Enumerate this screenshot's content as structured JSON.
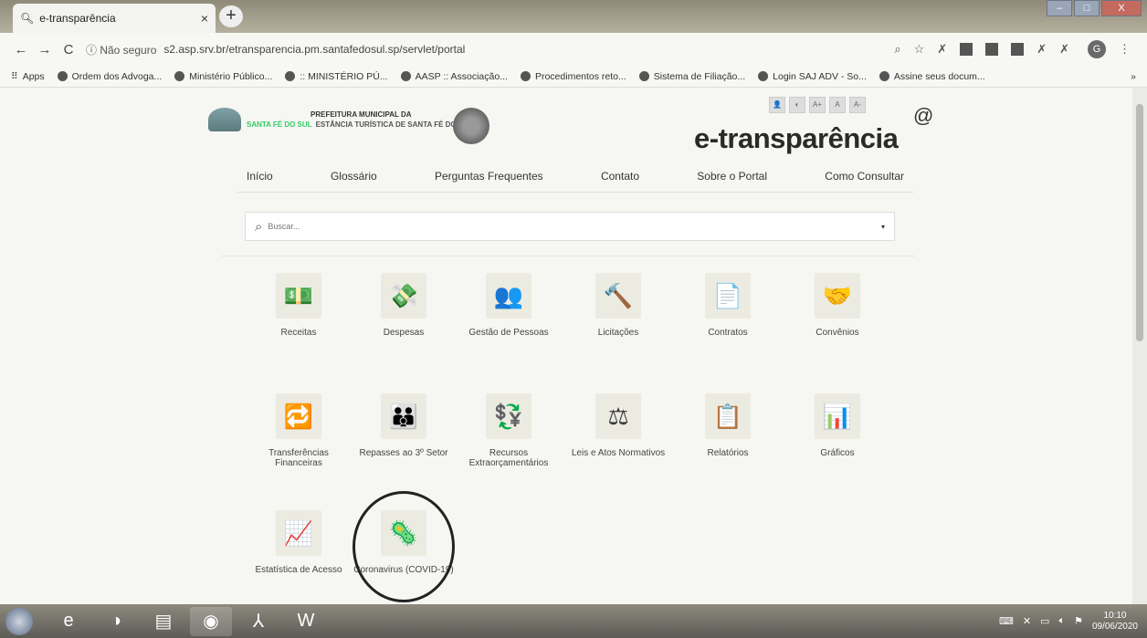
{
  "browser": {
    "tab_title": "e-transparência",
    "tab_close": "×",
    "new_tab": "+",
    "win_min": "–",
    "win_max": "□",
    "win_close": "X",
    "nav_back": "←",
    "nav_forward": "→",
    "nav_reload": "C",
    "security_label": "ⓘ Não seguro",
    "url": "s2.asp.srv.br/etransparencia.pm.santafedosul.sp/servlet/portal",
    "profile_initial": "G",
    "bookmarks": [
      {
        "label": "Apps"
      },
      {
        "label": "Ordem dos Advoga..."
      },
      {
        "label": "Ministério Público..."
      },
      {
        "label": ":: MINISTÉRIO PÚ..."
      },
      {
        "label": "AASP :: Associação..."
      },
      {
        "label": "Procedimentos reto..."
      },
      {
        "label": "Sistema de Filiação..."
      },
      {
        "label": "Login SAJ ADV - So..."
      },
      {
        "label": "Assine seus docum..."
      }
    ],
    "bookmarks_more": "»"
  },
  "site": {
    "pref_line1": "PREFEITURA MUNICIPAL DA",
    "pref_line2": "ESTÂNCIA TURÍSTICA DE SANTA FÉ DO SUL",
    "pref_small": "SANTA FÉ DO SUL",
    "access_tools": [
      "👤",
      "◐",
      "A+",
      "A",
      "A-"
    ],
    "brand": "e-transparência",
    "brand_at": "@",
    "nav": [
      "Início",
      "Glossário",
      "Perguntas Frequentes",
      "Contato",
      "Sobre o Portal",
      "Como Consultar"
    ],
    "search_placeholder": "Buscar...",
    "search_caret": "▾",
    "cards": [
      {
        "label": "Receitas",
        "icon": "💵"
      },
      {
        "label": "Despesas",
        "icon": "💸"
      },
      {
        "label": "Gestão de Pessoas",
        "icon": "👥"
      },
      {
        "label": "Licitações",
        "icon": "🔨"
      },
      {
        "label": "Contratos",
        "icon": "📄"
      },
      {
        "label": "Convênios",
        "icon": "🤝"
      },
      {
        "label": "Transferências Financeiras",
        "icon": "🔁"
      },
      {
        "label": "Repasses ao 3º Setor",
        "icon": "👪"
      },
      {
        "label": "Recursos Extraorçamentários",
        "icon": "💱"
      },
      {
        "label": "Leis e Atos Normativos",
        "icon": "⚖"
      },
      {
        "label": "Relatórios",
        "icon": "📋"
      },
      {
        "label": "Gráficos",
        "icon": "📊"
      },
      {
        "label": "Estatística de Acesso",
        "icon": "📈"
      },
      {
        "label": "Coronavirus (COVID-19)",
        "icon": "🦠"
      }
    ]
  },
  "taskbar": {
    "clock_time": "10:10",
    "clock_date": "09/06/2020"
  }
}
